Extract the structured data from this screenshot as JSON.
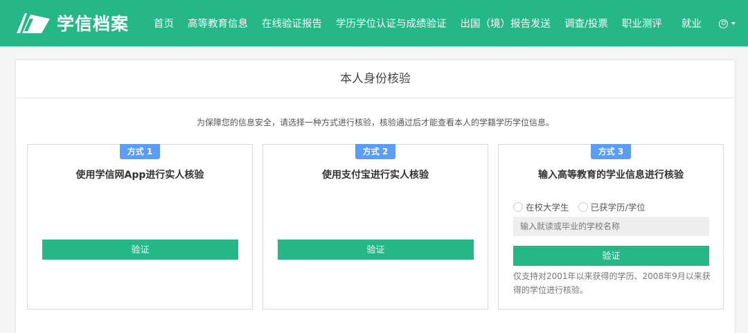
{
  "header": {
    "logo_text": "学信档案",
    "nav": [
      "首页",
      "高等教育信息",
      "在线验证报告",
      "学历学位认证与成绩验证",
      "出国（境）报告发送",
      "调查/投票",
      "职业测评",
      "就业"
    ]
  },
  "colors": {
    "brand": "#26b787",
    "badge": "#5b9cf5"
  },
  "page": {
    "title": "本人身份核验",
    "description": "为保障您的信息安全，请选择一种方式进行核验，核验通过后才能查看本人的学籍学历学位信息。"
  },
  "methods": [
    {
      "badge": "方式 1",
      "title": "使用学信网App进行实人核验",
      "button": "验证"
    },
    {
      "badge": "方式 2",
      "title": "使用支付宝进行实人核验",
      "button": "验证"
    },
    {
      "badge": "方式 3",
      "title": "输入高等教育的学业信息进行核验",
      "radios": [
        "在校大学生",
        "已获学历/学位"
      ],
      "input_placeholder": "输入就读或毕业的学校名称",
      "button": "验证",
      "note": "仅支持对2001年以来获得的学历、2008年9月以来获得的学位进行核验。"
    }
  ]
}
